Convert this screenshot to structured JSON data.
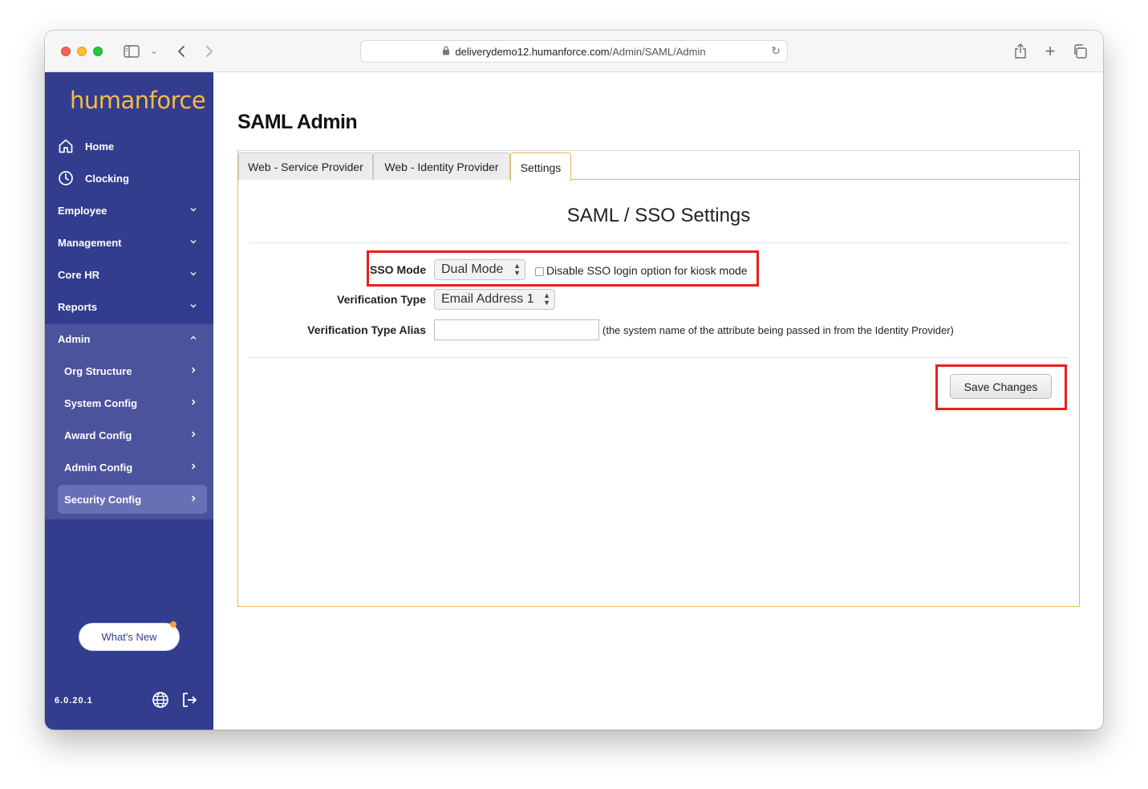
{
  "browser": {
    "url_domain": "deliverydemo12.humanforce.com",
    "url_path": "/Admin/SAML/Admin"
  },
  "sidebar": {
    "logo": "humanforce",
    "items": [
      {
        "label": "Home",
        "icon": "home-icon"
      },
      {
        "label": "Clocking",
        "icon": "clock-icon"
      },
      {
        "label": "Employee"
      },
      {
        "label": "Management"
      },
      {
        "label": "Core HR"
      },
      {
        "label": "Reports"
      },
      {
        "label": "Admin"
      }
    ],
    "admin_sub_items": [
      {
        "label": "Org Structure"
      },
      {
        "label": "System Config"
      },
      {
        "label": "Award Config"
      },
      {
        "label": "Admin Config"
      },
      {
        "label": "Security Config"
      }
    ],
    "whats_new_label": "What's New",
    "version": "6.0.20.1"
  },
  "page": {
    "title": "SAML Admin",
    "tabs": [
      {
        "label": "Web - Service Provider"
      },
      {
        "label": "Web - Identity Provider"
      },
      {
        "label": "Settings"
      }
    ],
    "panel_title": "SAML / SSO Settings",
    "form": {
      "sso_mode_label": "SSO Mode",
      "sso_mode_value": "Dual Mode",
      "kiosk_checkbox_label": "Disable SSO login option for kiosk mode",
      "kiosk_checkbox_checked": false,
      "verification_type_label": "Verification Type",
      "verification_type_value": "Email Address 1",
      "verification_alias_label": "Verification Type Alias",
      "verification_alias_value": "",
      "verification_alias_hint": "(the system name of the attribute being passed in from the Identity Provider)"
    },
    "save_label": "Save Changes"
  }
}
